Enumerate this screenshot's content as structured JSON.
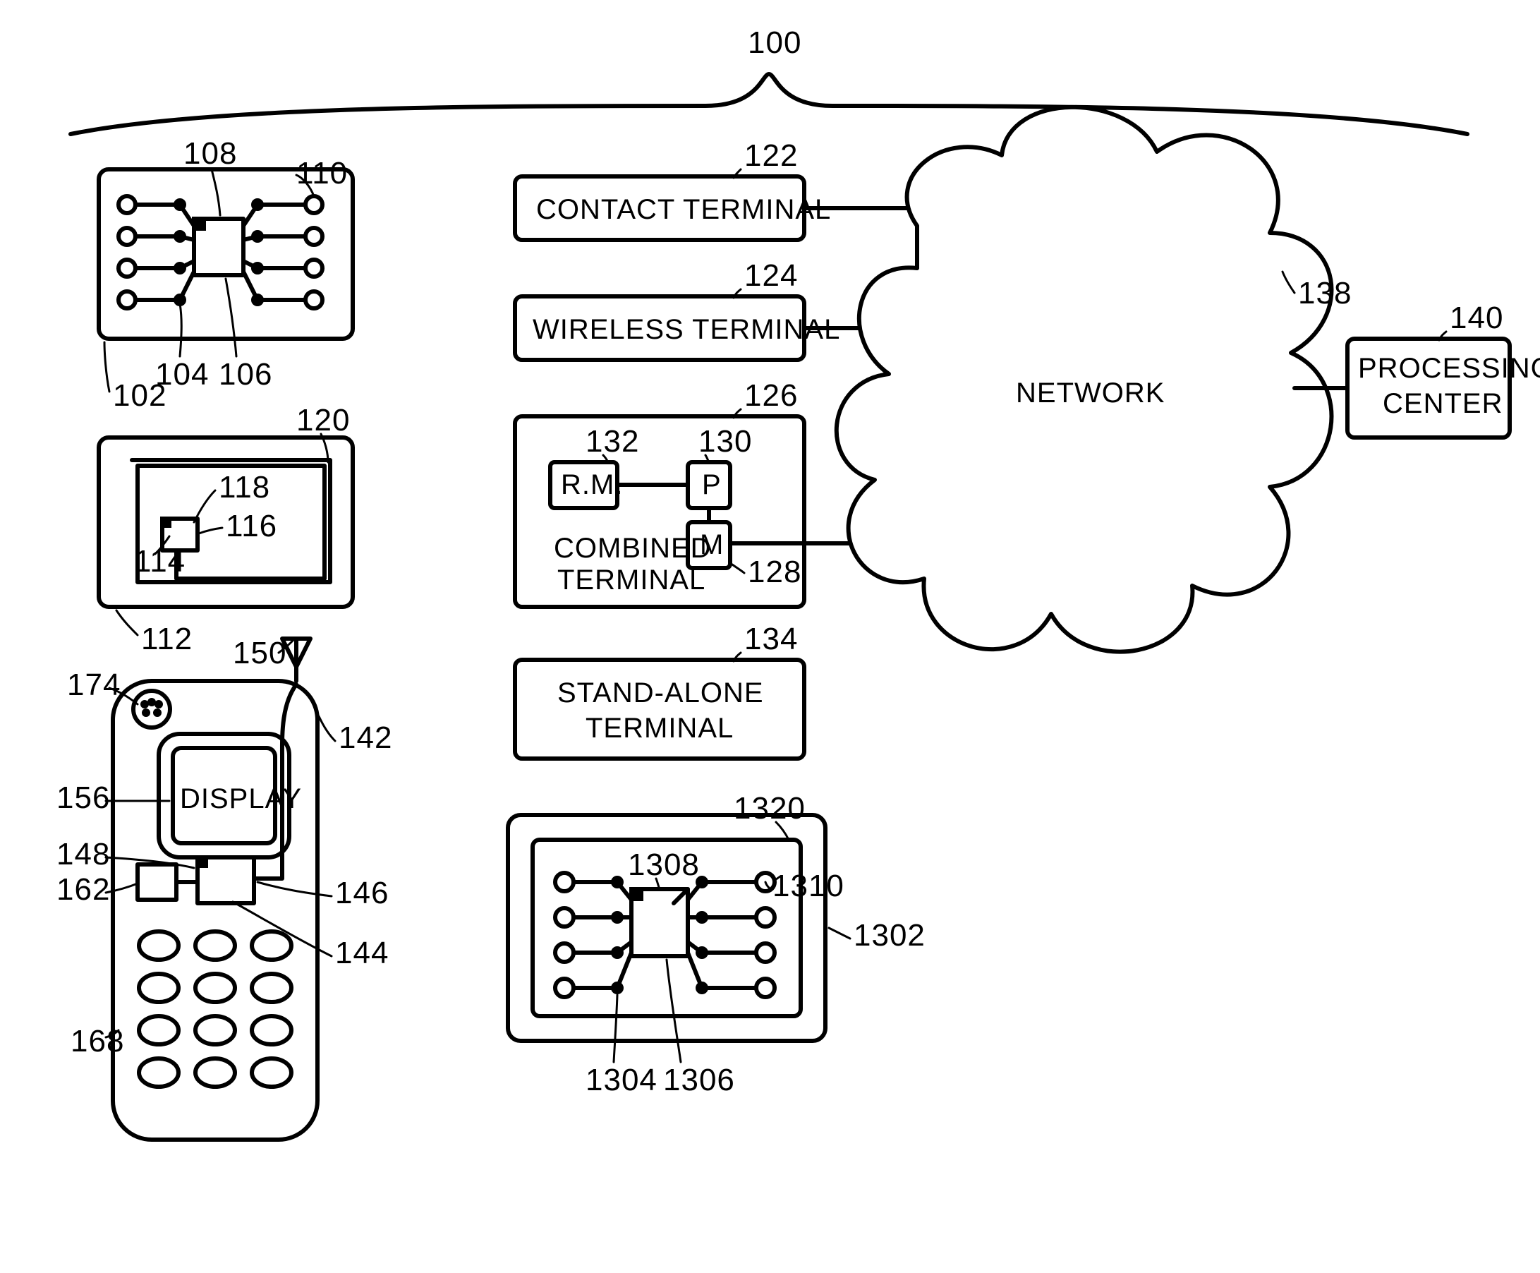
{
  "refs": {
    "100": "100",
    "102": "102",
    "104": "104",
    "106": "106",
    "108": "108",
    "110": "110",
    "112": "112",
    "114": "114",
    "116": "116",
    "118": "118",
    "120": "120",
    "142": "142",
    "144": "144",
    "146": "146",
    "148": "148",
    "150": "150",
    "156": "156",
    "162": "162",
    "168": "168",
    "174": "174",
    "122": "122",
    "124": "124",
    "126": "126",
    "128": "128",
    "130": "130",
    "132": "132",
    "134": "134",
    "138": "138",
    "140": "140",
    "1302": "1302",
    "1304": "1304",
    "1306": "1306",
    "1308": "1308",
    "1310": "1310",
    "1320": "1320"
  },
  "labels": {
    "contact": "CONTACT TERMINAL",
    "wireless": "WIRELESS TERMINAL",
    "combined": "COMBINED",
    "terminal": "TERMINAL",
    "standalone1": "STAND-ALONE",
    "standalone2": "TERMINAL",
    "rm": "R.M.",
    "p": "P",
    "m": "M",
    "network": "NETWORK",
    "processing": "PROCESSING",
    "center": "CENTER",
    "display": "DISPLAY"
  }
}
